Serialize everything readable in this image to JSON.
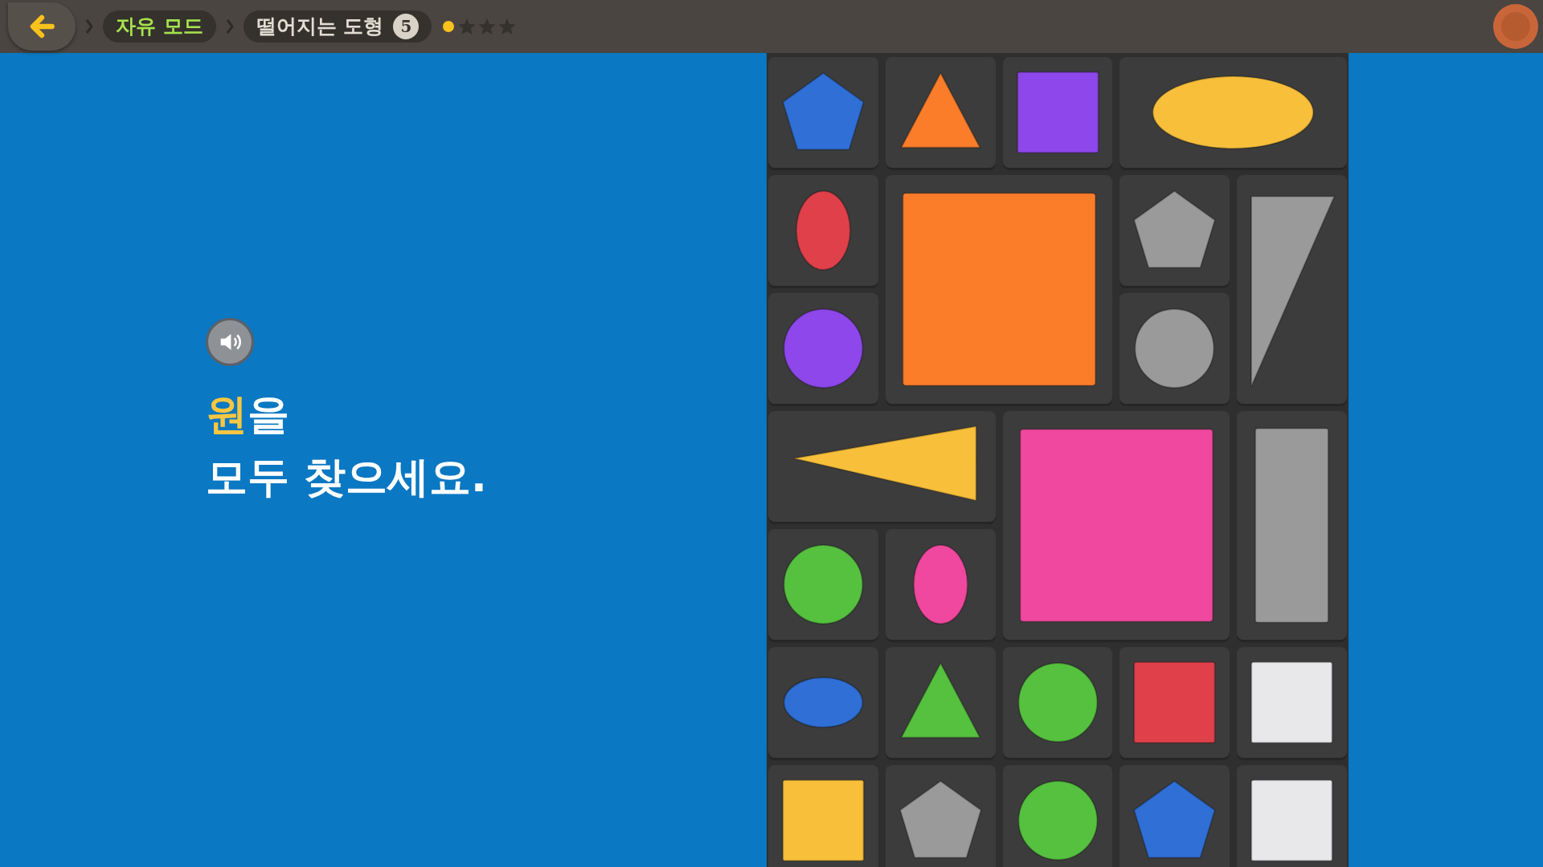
{
  "top_bar": {
    "breadcrumbs": [
      {
        "label": "자유 모드",
        "kind": "mode"
      },
      {
        "label": "떨어지는 도형",
        "kind": "game",
        "badge": "5"
      }
    ],
    "stars": 0
  },
  "prompt": {
    "lines": [
      {
        "parts": [
          {
            "text": "원",
            "highlight": true
          },
          {
            "text": "을",
            "highlight": false
          }
        ]
      },
      {
        "parts": [
          {
            "text": "모두 찾으세요.",
            "highlight": false
          }
        ]
      }
    ]
  },
  "board": [
    {
      "kind": "pentagon",
      "wide": false,
      "tall": false,
      "color": "#2f6fd6"
    },
    {
      "kind": "triangle",
      "wide": false,
      "tall": false,
      "color": "#fb7d2a"
    },
    {
      "kind": "square",
      "wide": false,
      "tall": false,
      "color": "#8e47ea"
    },
    {
      "kind": "ellipse",
      "wide": true,
      "tall": false,
      "color": "#f8bf3b"
    },
    {
      "kind": "ellipse",
      "wide": false,
      "tall": false,
      "vertical": true,
      "color": "#e0404a"
    },
    {
      "kind": "square",
      "wide": true,
      "tall": true,
      "color": "#fb7d2a"
    },
    {
      "kind": "pentagon",
      "wide": false,
      "tall": false,
      "color": "#9a9a9a"
    },
    {
      "kind": "triangle",
      "wide": false,
      "tall": true,
      "color": "#9a9a9a"
    },
    {
      "kind": "circle",
      "wide": false,
      "tall": false,
      "color": "#8e47ea"
    },
    {
      "kind": "circle",
      "wide": false,
      "tall": false,
      "color": "#9a9a9a"
    },
    {
      "kind": "triangle",
      "wide": true,
      "tall": false,
      "color": "#f8bf3b"
    },
    {
      "kind": "square",
      "wide": true,
      "tall": true,
      "color": "#f0489e"
    },
    {
      "kind": "rectangle",
      "wide": false,
      "tall": true,
      "color": "#9a9a9a"
    },
    {
      "kind": "circle",
      "wide": false,
      "tall": false,
      "color": "#56c13f"
    },
    {
      "kind": "ellipse",
      "wide": false,
      "tall": false,
      "vertical": true,
      "color": "#f0489e"
    },
    {
      "kind": "ellipse",
      "wide": false,
      "tall": false,
      "vertical": false,
      "color": "#2f6fd6"
    },
    {
      "kind": "triangle",
      "wide": false,
      "tall": false,
      "color": "#56c13f"
    },
    {
      "kind": "circle",
      "wide": false,
      "tall": false,
      "color": "#56c13f"
    },
    {
      "kind": "square",
      "wide": false,
      "tall": false,
      "color": "#e0404a"
    },
    {
      "kind": "square",
      "wide": false,
      "tall": false,
      "color": "#e8e8ea"
    },
    {
      "kind": "square",
      "wide": false,
      "tall": false,
      "color": "#f8bf3b"
    },
    {
      "kind": "pentagon",
      "wide": false,
      "tall": false,
      "color": "#9a9a9a"
    },
    {
      "kind": "circle",
      "wide": false,
      "tall": false,
      "color": "#56c13f"
    },
    {
      "kind": "pentagon",
      "wide": false,
      "tall": false,
      "color": "#2f6fd6"
    },
    {
      "kind": "square",
      "wide": false,
      "tall": false,
      "color": "#e8e8ea"
    }
  ]
}
